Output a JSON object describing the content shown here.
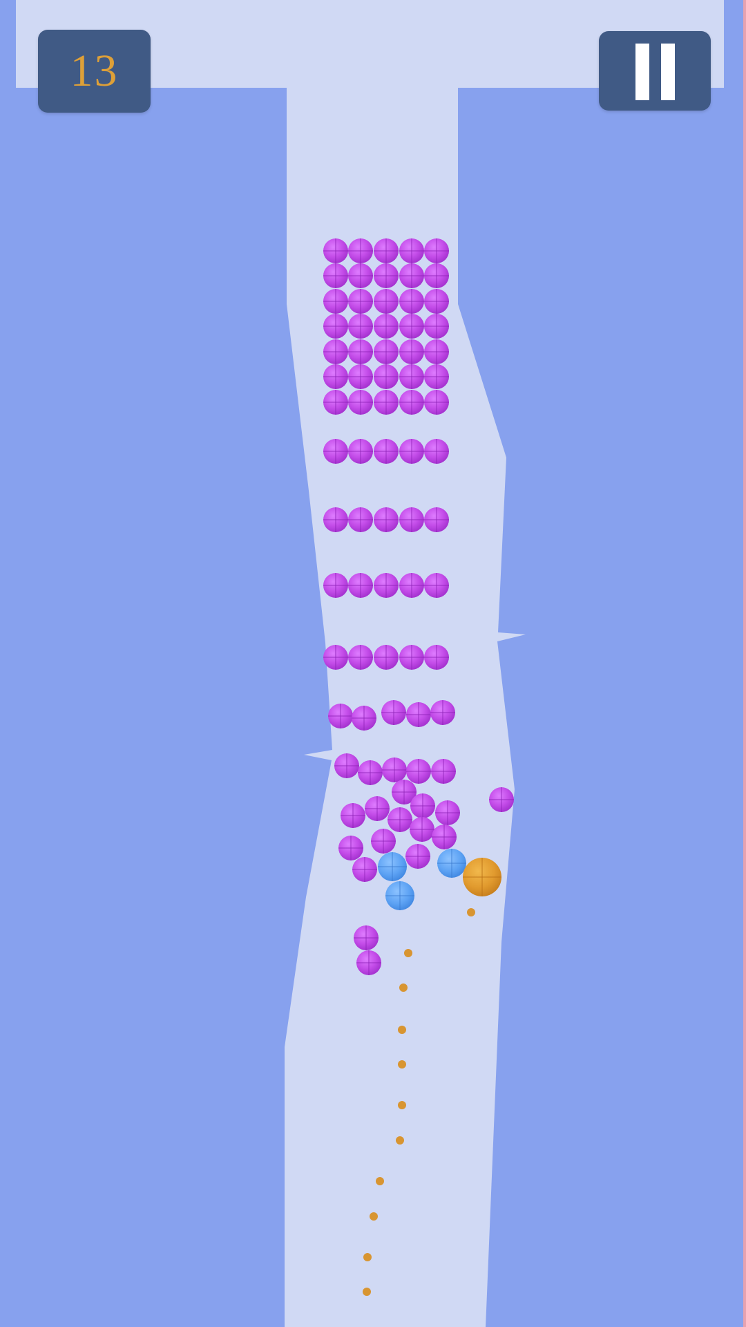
{
  "hud": {
    "score": "13",
    "pause_icon": "pause-icon"
  },
  "colors": {
    "background": "#87a1ee",
    "track": "#d0d9f4",
    "pink_ball": "#c94ef0",
    "blue_ball": "#5ea5f5",
    "player_ball": "#e49a2f",
    "aim_dot": "#d89531",
    "hud_box": "#405a85",
    "score_text": "#dea038"
  },
  "game": {
    "pink_ball_count": 82,
    "blue_ball_count": 3,
    "player_ball_count": 1,
    "aim_dot_count": 12
  }
}
